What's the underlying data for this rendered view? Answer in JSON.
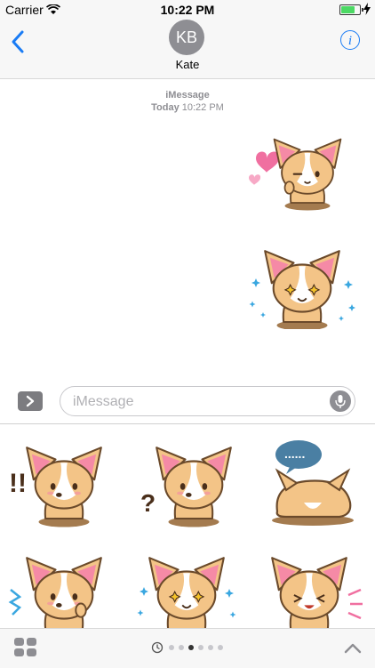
{
  "status_bar": {
    "carrier": "Carrier",
    "time": "10:22 PM",
    "battery_level": 0.85
  },
  "nav": {
    "avatar_initials": "KB",
    "contact_name": "Kate"
  },
  "conversation": {
    "service": "iMessage",
    "day": "Today",
    "time": "10:22 PM",
    "stickers": [
      {
        "name": "corgi-wink-hearts"
      },
      {
        "name": "corgi-sparkle-eyes"
      }
    ]
  },
  "input": {
    "placeholder": "iMessage",
    "value": ""
  },
  "sticker_drawer": {
    "items": [
      {
        "name": "corgi-surprised"
      },
      {
        "name": "corgi-confused"
      },
      {
        "name": "corgi-sleeping"
      },
      {
        "name": "corgi-thumb-up"
      },
      {
        "name": "corgi-sparkle"
      },
      {
        "name": "corgi-laughing"
      }
    ],
    "page_count": 6,
    "active_page": 2
  },
  "colors": {
    "accent": "#1a7cf5",
    "corgi_fur": "#f3c487",
    "corgi_ear": "#f58aa6",
    "sparkle": "#3aa7e0"
  }
}
